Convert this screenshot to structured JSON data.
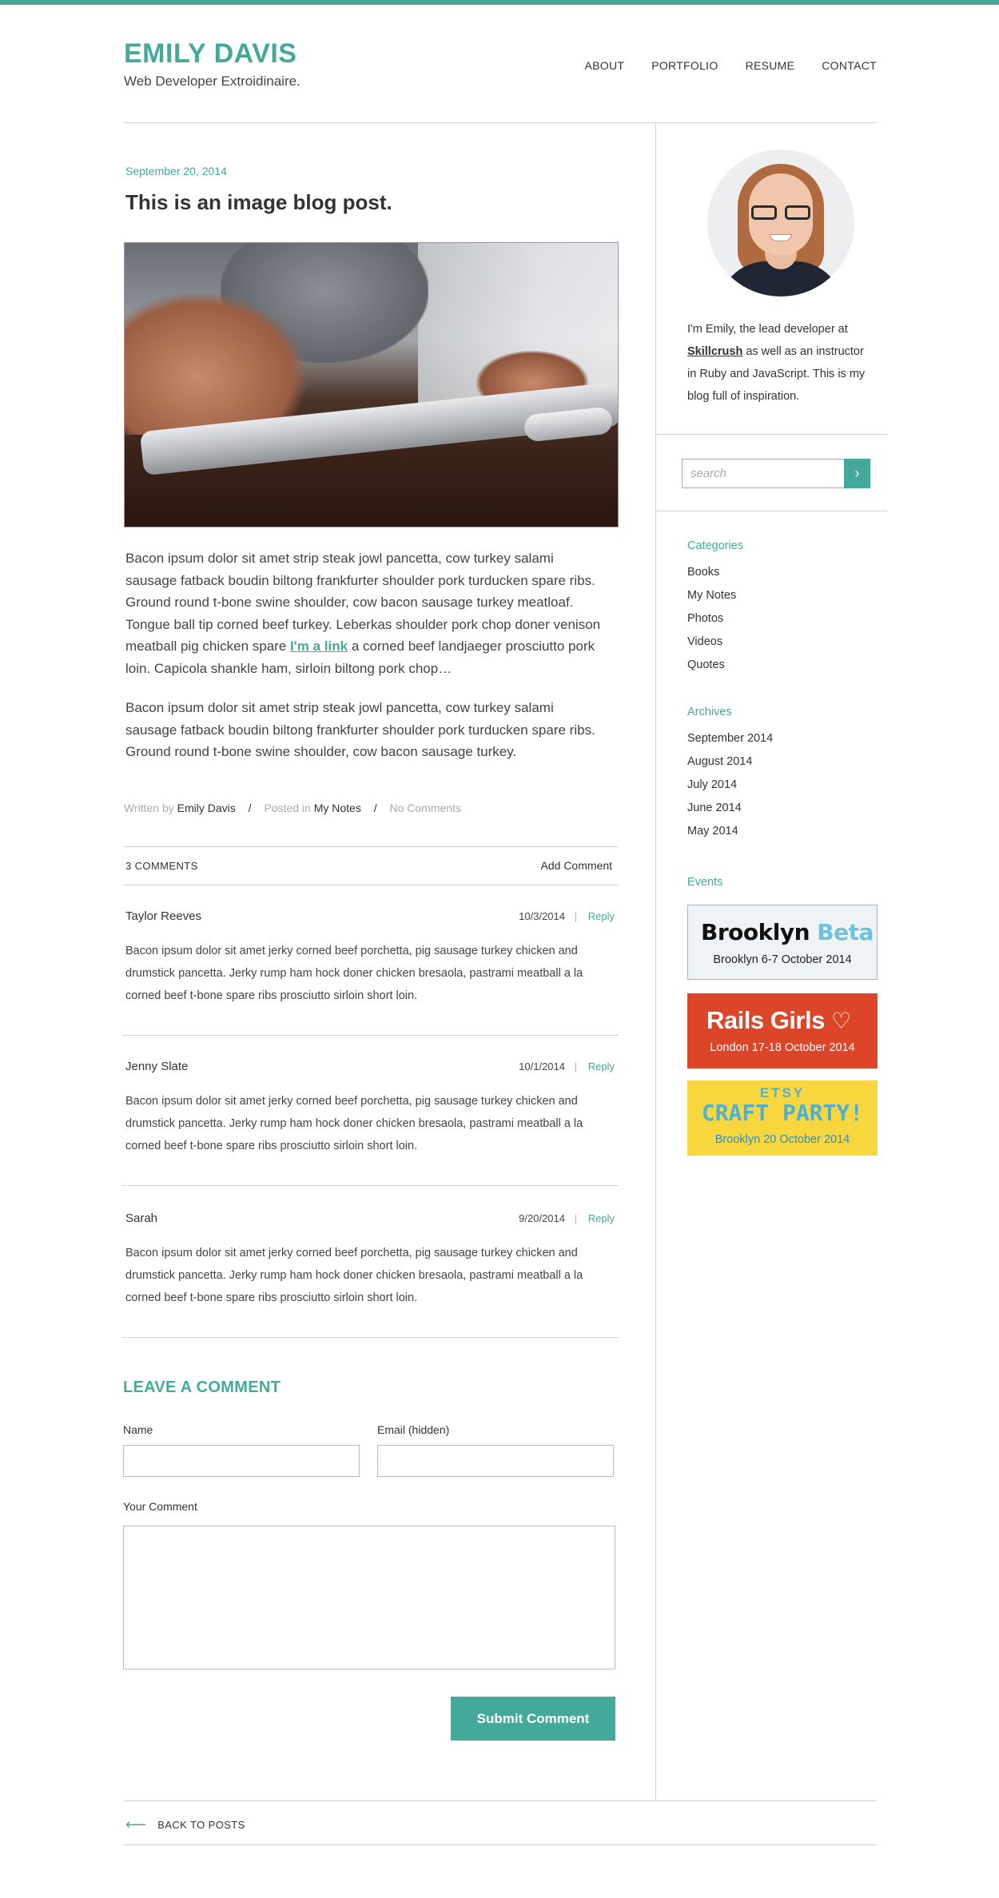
{
  "header": {
    "site_title": "EMILY DAVIS",
    "tagline": "Web Developer Extroidinaire.",
    "nav": [
      "ABOUT",
      "PORTFOLIO",
      "RESUME",
      "CONTACT"
    ]
  },
  "colors": {
    "accent": "#45a99a",
    "rails_red": "#dc4527",
    "etsy_yellow": "#f8d63e"
  },
  "post": {
    "date": "September 20, 2014",
    "title": "This is an image blog post.",
    "para1_before": "Bacon ipsum dolor sit amet strip steak jowl pancetta, cow turkey salami sausage fatback boudin biltong frankfurter shoulder pork turducken spare ribs. Ground round t-bone swine shoulder, cow bacon sausage turkey meatloaf. Tongue ball tip corned beef turkey. Leberkas shoulder pork chop doner venison meatball pig chicken spare ",
    "para1_link": "I'm a link",
    "para1_after": " a corned beef landjaeger prosciutto pork loin. Capicola shankle ham, sirloin biltong pork chop…",
    "para2": "Bacon ipsum dolor sit amet strip steak jowl pancetta, cow turkey salami sausage fatback boudin biltong frankfurter shoulder pork turducken spare ribs. Ground round t-bone swine shoulder, cow bacon sausage turkey.",
    "meta": {
      "written_by_label": "Written by",
      "author": "Emily Davis",
      "posted_in_label": "Posted in",
      "category": "My Notes",
      "comments": "No Comments",
      "separator": "/"
    }
  },
  "comments": {
    "count_label": "3 COMMENTS",
    "add_label": "Add Comment",
    "reply_label": "Reply",
    "bar": "|",
    "items": [
      {
        "author": "Taylor Reeves",
        "date": "10/3/2014",
        "text": "Bacon ipsum dolor sit amet jerky corned beef porchetta, pig sausage turkey chicken and drumstick pancetta. Jerky rump ham hock doner chicken bresaola, pastrami meatball a la corned beef t-bone spare ribs prosciutto sirloin short loin."
      },
      {
        "author": "Jenny Slate",
        "date": "10/1/2014",
        "text": "Bacon ipsum dolor sit amet jerky corned beef porchetta, pig sausage turkey chicken and drumstick pancetta. Jerky rump ham hock doner chicken bresaola, pastrami meatball a la corned beef t-bone spare ribs prosciutto sirloin short loin."
      },
      {
        "author": "Sarah",
        "date": "9/20/2014",
        "text": "Bacon ipsum dolor sit amet jerky corned beef porchetta, pig sausage turkey chicken and drumstick pancetta. Jerky rump ham hock doner chicken bresaola, pastrami meatball a la corned beef t-bone spare ribs prosciutto sirloin short loin."
      }
    ]
  },
  "form": {
    "title": "LEAVE A COMMENT",
    "name_label": "Name",
    "email_label": "Email (hidden)",
    "comment_label": "Your Comment",
    "submit_label": "Submit Comment"
  },
  "footer": {
    "back_label": "BACK TO POSTS",
    "back_arrow": "⟵"
  },
  "sidebar": {
    "bio_before": "I'm Emily, the lead developer at ",
    "bio_link": "Skillcrush",
    "bio_after": " as well as an instructor in Ruby and JavaScript. This is my blog full of inspiration.",
    "search_placeholder": "search",
    "search_icon": "chevron-right-icon",
    "categories_title": "Categories",
    "categories": [
      "Books",
      "My Notes",
      "Photos",
      "Videos",
      "Quotes"
    ],
    "archives_title": "Archives",
    "archives": [
      "September 2014",
      "August 2014",
      "July 2014",
      "June 2014",
      "May 2014"
    ],
    "events_title": "Events",
    "events": [
      {
        "title": "Brooklyn",
        "title2": "Beta",
        "sub": "Brooklyn 6-7 October 2014"
      },
      {
        "title": "Rails Girls",
        "sub": "London 17-18 October 2014"
      },
      {
        "title_top": "ETSY",
        "title": "CRAFT PARTY!",
        "sub": "Brooklyn 20 October 2014"
      }
    ]
  }
}
